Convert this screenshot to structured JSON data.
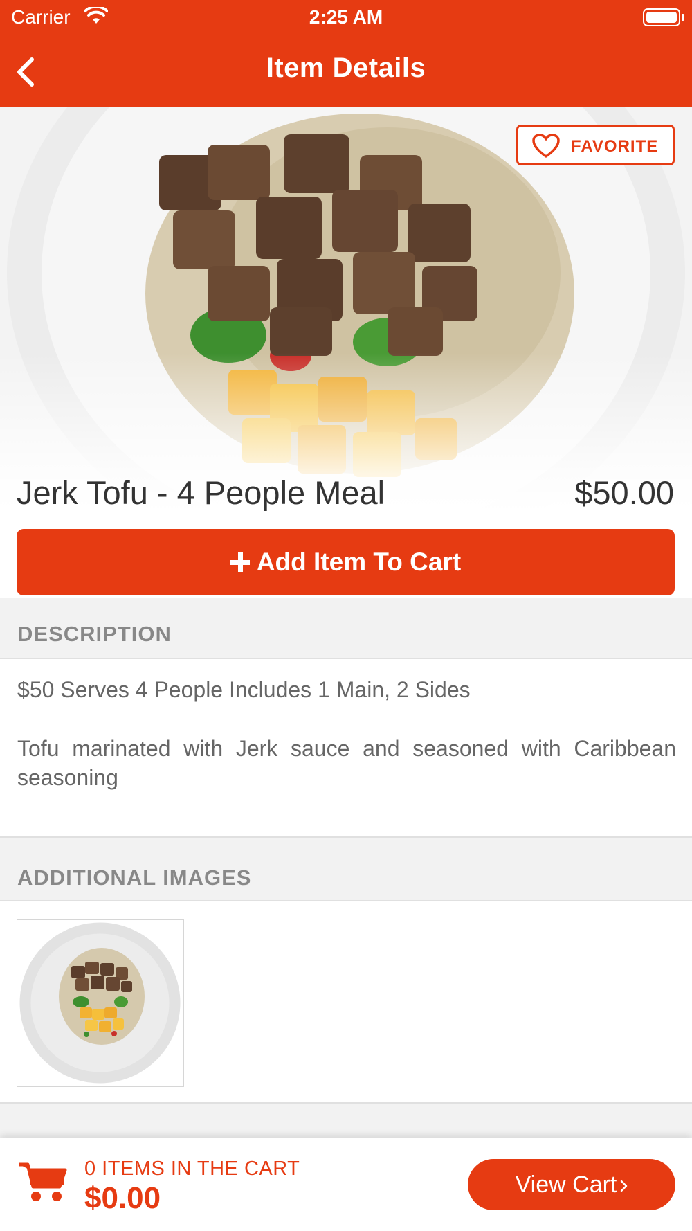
{
  "status_bar": {
    "carrier": "Carrier",
    "time": "2:25 AM"
  },
  "nav": {
    "title": "Item Details",
    "back_icon": "chevron-left-icon"
  },
  "hero": {
    "favorite_label": "FAVORITE",
    "favorite_icon": "heart-outline-icon"
  },
  "item": {
    "name": "Jerk Tofu - 4 People Meal",
    "price": "$50.00",
    "add_to_cart_label": "Add Item To Cart"
  },
  "description": {
    "header": "DESCRIPTION",
    "line1": "$50 Serves 4 People Includes 1 Main, 2 Sides",
    "line2": "Tofu marinated with Jerk sauce and seasoned with Caribbean seasoning"
  },
  "additional_images": {
    "header": "ADDITIONAL IMAGES"
  },
  "cart": {
    "count_text": "0 ITEMS IN THE CART",
    "total": "$0.00",
    "view_cart_label": "View Cart"
  },
  "colors": {
    "brand": "#e63b12",
    "section_bg": "#f2f2f2",
    "muted_text": "#888888"
  }
}
